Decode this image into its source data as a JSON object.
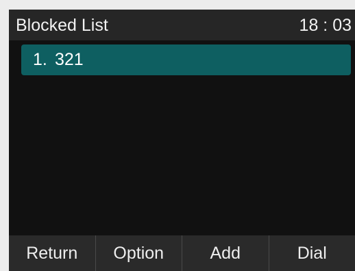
{
  "header": {
    "title": "Blocked List",
    "time": "18 : 03"
  },
  "list": {
    "items": [
      {
        "index": "1.",
        "number": "321",
        "selected": true
      }
    ]
  },
  "softkeys": [
    "Return",
    "Option",
    "Add",
    "Dial"
  ],
  "colors": {
    "background": "#111111",
    "header": "#262626",
    "selection": "#0e5f61",
    "softkey_bar": "#2a2a2a",
    "text": "#f2f2f2"
  }
}
